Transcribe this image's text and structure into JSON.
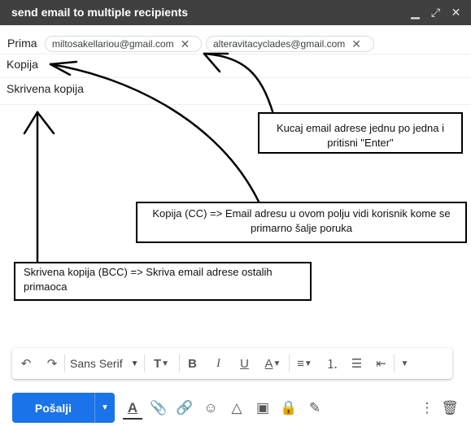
{
  "window": {
    "title": "send email to multiple recipients",
    "icons": [
      "minimize-icon",
      "fullscreen-icon",
      "close-icon"
    ]
  },
  "recipients": {
    "to_label": "Prima",
    "cc_label": "Kopija",
    "bcc_label": "Skrivena kopija",
    "chips": [
      {
        "email": "miltosakellariou@gmail.com"
      },
      {
        "email": "alteravitacyclades@gmail.com"
      }
    ]
  },
  "annotations": {
    "enter_note": "Kucaj email adrese jednu po jedna i pritisni \"Enter\"",
    "cc_note": "Kopija (CC) => Email adresu u ovom polju vidi korisnik kome se primarno šalje poruka",
    "bcc_note": "Skrivena kopija (BCC) => Skriva email adrese ostalih primaoca"
  },
  "toolbar": {
    "font_name": "Sans Serif",
    "icons": [
      "undo-icon",
      "redo-icon",
      "text-size-icon",
      "bold-icon",
      "italic-icon",
      "underline-icon",
      "text-color-icon",
      "align-icon",
      "numbered-list-icon",
      "bulleted-list-icon",
      "indent-less-icon",
      "more-formatting-icon"
    ]
  },
  "bottom": {
    "send_label": "Pošalji",
    "icons": [
      "formatting-icon",
      "attach-icon",
      "link-icon",
      "emoji-icon",
      "drive-icon",
      "photo-icon",
      "confidential-icon",
      "signature-icon",
      "more-options-icon",
      "delete-icon"
    ]
  }
}
